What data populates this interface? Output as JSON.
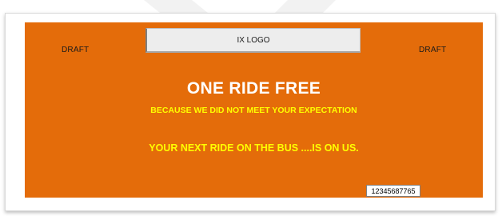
{
  "ticket": {
    "draft_left": "DRAFT",
    "draft_right": "DRAFT",
    "logo_placeholder": "IX LOGO",
    "headline": "ONE RIDE FREE",
    "reason": "BECAUSE WE DID NOT MEET YOUR EXPECTATION",
    "offer": "YOUR NEXT RIDE ON THE BUS ....IS ON US.",
    "serial_number": "12345687765"
  },
  "colors": {
    "ticket_background": "#e46c0a",
    "headline_text": "#ffffff",
    "accent_text": "#ffff00",
    "logo_box_background": "#ededed"
  }
}
